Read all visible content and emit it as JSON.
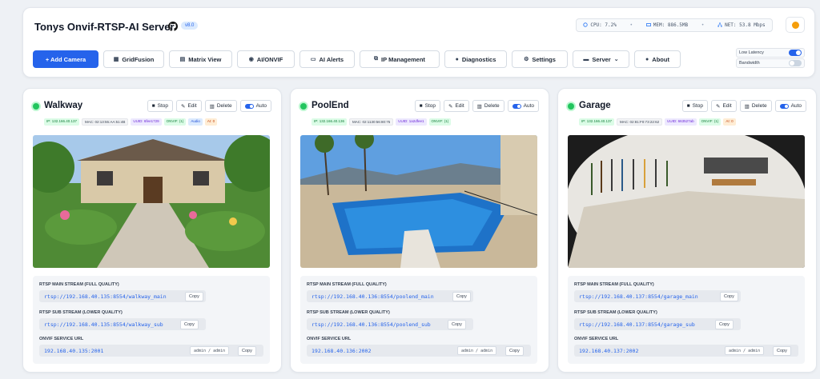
{
  "header": {
    "title": "Tonys Onvif-RTSP-AI Server",
    "version": "v8.0",
    "stats": {
      "cpu": "CPU: 7.2%",
      "mem": "MEM: 886.5MB",
      "net": "NET: 53.8 Mbps"
    }
  },
  "toolbar": {
    "add_camera": "+ Add Camera",
    "gridfusion": "GridFusion",
    "matrix_view": "Matrix View",
    "ai_onvif": "AI/ONVIF",
    "ai_alerts": "AI Alerts",
    "ip_management": "IP Management",
    "diagnostics": "Diagnostics",
    "settings": "Settings",
    "server": "Server",
    "about": "About"
  },
  "toggles": {
    "low_latency": {
      "label": "Low Latency",
      "on": true
    },
    "bandwidth": {
      "label": "Bandwidth",
      "on": false
    }
  },
  "card_labels": {
    "stop": "Stop",
    "edit": "Edit",
    "delete": "Delete",
    "auto": "Auto",
    "main_stream": "RTSP MAIN STREAM (FULL QUALITY)",
    "sub_stream": "RTSP SUB STREAM (LOWER QUALITY)",
    "onvif_url": "ONVIF SERVICE URL",
    "copy": "Copy"
  },
  "cameras": [
    {
      "name": "Walkway",
      "badges": {
        "ip": "IP: 132.166.40.137",
        "mac": "MAC: 02:13:55:AA:51:4B",
        "uuid": "UUID: 6fee1729",
        "onvif": "ONVIF: (1)",
        "audio": "Audio",
        "ai": "AI: 0"
      },
      "main": "rtsp://192.168.40.135:8554/walkway_main",
      "sub": "rtsp://192.168.40.135:8554/walkway_sub",
      "onvif": "192.168.40.135:2001",
      "cred": "admin / admin"
    },
    {
      "name": "PoolEnd",
      "badges": {
        "ip": "IP: 132.166.40.136",
        "mac": "MAC: 02:1130:56:80:75",
        "uuid": "UUID: 1a2dfee1",
        "onvif": "ONVIF: (1)"
      },
      "main": "rtsp://192.168.40.136:8554/poolend_main",
      "sub": "rtsp://192.168.40.136:8554/poolend_sub",
      "onvif": "192.168.40.136:2002",
      "cred": "admin / admin"
    },
    {
      "name": "Garage",
      "badges": {
        "ip": "IP: 132.166.40.137",
        "mac": "MAC: 02:81:F0:73:22:62",
        "uuid": "UUID: 663527ab",
        "onvif": "ONVIF: (1)",
        "ai": "AI: 0"
      },
      "main": "rtsp://192.168.40.137:8554/garage_main",
      "sub": "rtsp://192.168.40.137:8554/garage_sub",
      "onvif": "192.168.40.137:2002",
      "cred": "admin / admin"
    }
  ],
  "colors": {
    "accent": "#2563eb",
    "online": "#22c55e"
  }
}
